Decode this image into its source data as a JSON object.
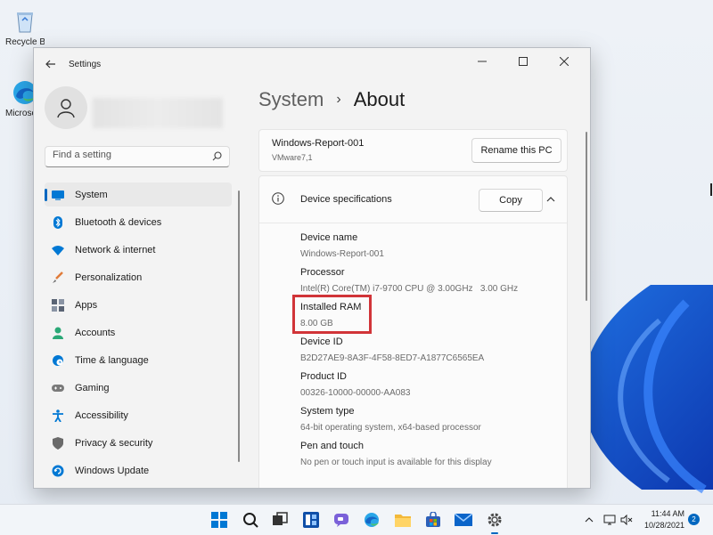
{
  "desktop": {
    "icons": [
      {
        "label": "Recycle Bin",
        "icon": "recycle-bin-icon"
      },
      {
        "label": "Microsoft Edge",
        "icon": "edge-icon"
      }
    ]
  },
  "window": {
    "title": "Settings",
    "controls": {
      "minimize": "minimize-icon",
      "maximize": "maximize-icon",
      "close": "close-icon"
    }
  },
  "sidebar": {
    "search_placeholder": "Find a setting",
    "items": [
      {
        "label": "System",
        "icon": "system-icon",
        "color": "#0078d4",
        "active": true
      },
      {
        "label": "Bluetooth & devices",
        "icon": "bluetooth-icon",
        "color": "#0078d4"
      },
      {
        "label": "Network & internet",
        "icon": "wifi-icon",
        "color": "#0078d4"
      },
      {
        "label": "Personalization",
        "icon": "brush-icon",
        "color": "#e07b39"
      },
      {
        "label": "Apps",
        "icon": "apps-icon",
        "color": "#5a6474"
      },
      {
        "label": "Accounts",
        "icon": "accounts-icon",
        "color": "#2aa876"
      },
      {
        "label": "Time & language",
        "icon": "globe-clock-icon",
        "color": "#0078d4"
      },
      {
        "label": "Gaming",
        "icon": "gamepad-icon",
        "color": "#7a7a7a"
      },
      {
        "label": "Accessibility",
        "icon": "accessibility-icon",
        "color": "#0078d4"
      },
      {
        "label": "Privacy & security",
        "icon": "shield-icon",
        "color": "#6a6a6a"
      },
      {
        "label": "Windows Update",
        "icon": "update-icon",
        "color": "#0078d4"
      }
    ]
  },
  "main": {
    "breadcrumb": {
      "parent": "System",
      "separator": "›",
      "current": "About"
    },
    "pc": {
      "name": "Windows-Report-001",
      "model": "VMware7,1",
      "rename_label": "Rename this PC"
    },
    "specs": {
      "title": "Device specifications",
      "copy_label": "Copy",
      "fields": [
        {
          "label": "Device name",
          "value": "Windows-Report-001"
        },
        {
          "label": "Processor",
          "value": "Intel(R) Core(TM) i7-9700 CPU @ 3.00GHz   3.00 GHz"
        },
        {
          "label": "Installed RAM",
          "value": "8.00 GB"
        },
        {
          "label": "Device ID",
          "value": "B2D27AE9-8A3F-4F58-8ED7-A1877C6565EA"
        },
        {
          "label": "Product ID",
          "value": "00326-10000-00000-AA083"
        },
        {
          "label": "System type",
          "value": "64-bit operating system, x64-based processor"
        },
        {
          "label": "Pen and touch",
          "value": "No pen or touch input is available for this display"
        }
      ]
    }
  },
  "taskbar": {
    "apps": [
      "start-icon",
      "search-icon",
      "task-view-icon",
      "widgets-icon",
      "chat-icon",
      "edge-icon",
      "file-explorer-icon",
      "store-icon",
      "mail-icon",
      "settings-icon"
    ],
    "active_app": "settings-icon",
    "time": "11:44 AM",
    "date": "10/28/2021",
    "notification_count": "2"
  },
  "colors": {
    "accent": "#0067c0",
    "highlight": "#d13438"
  }
}
